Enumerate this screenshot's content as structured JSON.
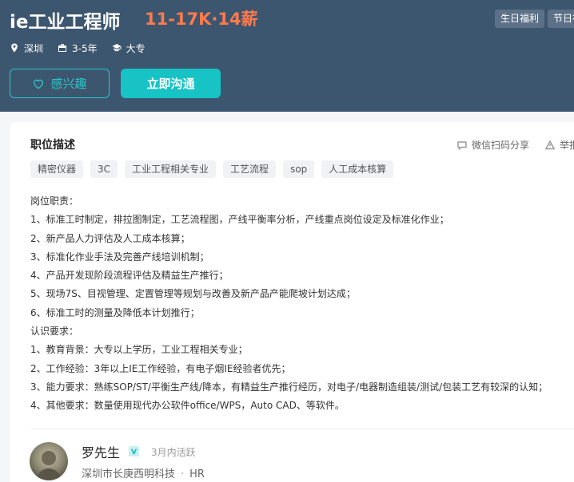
{
  "job": {
    "title": "ie工业工程师",
    "salary": "11-17K·14薪",
    "welfare": [
      "生日福利",
      "节日福"
    ],
    "location": "深圳",
    "experience": "3-5年",
    "education": "大专"
  },
  "actions": {
    "interest_label": "感兴趣",
    "chat_label": "立即沟通"
  },
  "description": {
    "section_title": "职位描述",
    "share_label": "微信扫码分享",
    "report_label": "举报",
    "tags": [
      "精密仪器",
      "3C",
      "工业工程相关专业",
      "工艺流程",
      "sop",
      "人工成本核算"
    ],
    "lines": [
      "岗位职责：",
      "1、标准工时制定，排拉图制定，工艺流程图，产线平衡率分析，产线重点岗位设定及标准化作业；",
      "2、新产品人力评估及人工成本核算；",
      "3、标准化作业手法及完善产线培训机制；",
      "4、产品开发现阶段流程评估及精益生产推行；",
      "5、现场7S、目视管理、定置管理等规划与改善及新产品产能爬坡计划达成；",
      "6、标准工时的测量及降低本计划推行；",
      "认识要求：",
      "1、教育背景：大专以上学历，工业工程相关专业；",
      "2、工作经验：3年以上IE工作经验，有电子烟IE经验者优先；",
      "3、能力要求：熟练SOP/ST/平衡生产线/降本，有精益生产推行经历，对电子/电器制造组装/测试/包装工艺有较深的认知；",
      "4、其他要求：数量使用现代办公软件office/WPS，Auto CAD、等软件。"
    ]
  },
  "recruiter": {
    "name": "罗先生",
    "active_status": "3月内活跃",
    "company": "深圳市长庚西明科技",
    "role": "HR"
  },
  "colors": {
    "header_bg": "#3d5670",
    "salary": "#ff7a4d",
    "accent": "#17c3c5"
  },
  "icons": {
    "location": "location-pin-icon",
    "experience": "briefcase-icon",
    "education": "graduation-cap-icon",
    "interest": "heart-icon",
    "share": "chat-bubble-icon",
    "report": "warning-triangle-icon",
    "verified": "verified-badge-icon"
  }
}
